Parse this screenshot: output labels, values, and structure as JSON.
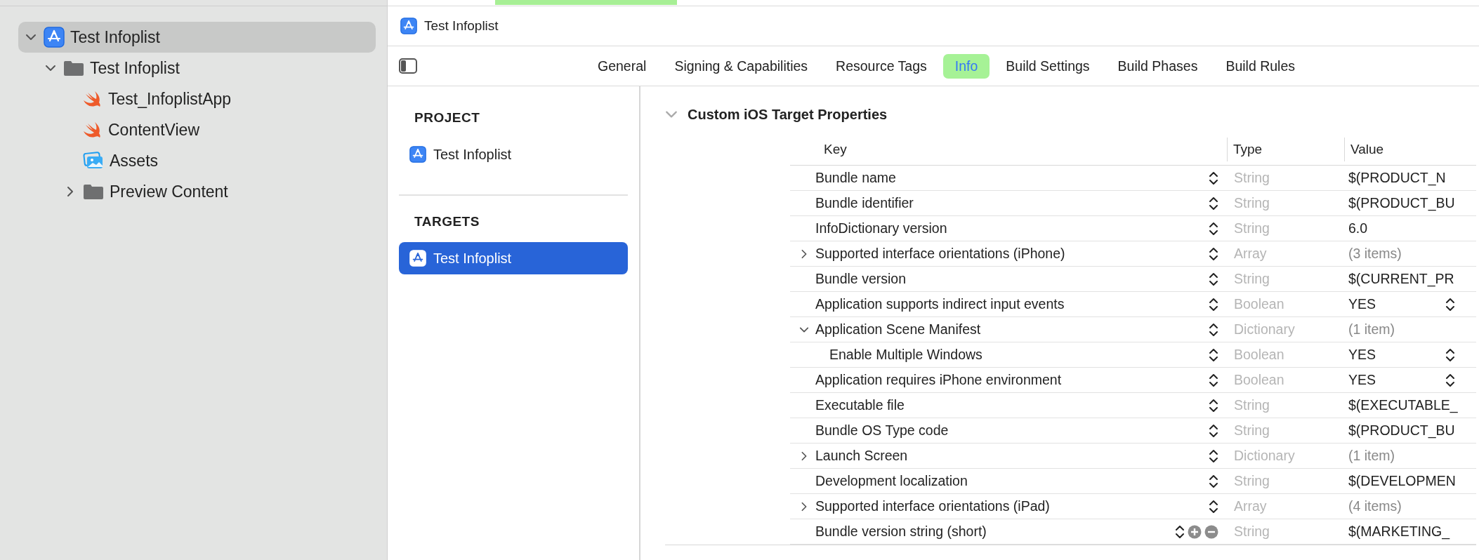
{
  "navigator": {
    "items": [
      {
        "label": "Test Infoplist",
        "kind": "project",
        "selected": true,
        "expanded": true,
        "children": [
          {
            "label": "Test Infoplist",
            "kind": "folder",
            "selected": false,
            "expanded": true,
            "children": [
              {
                "label": "Test_InfoplistApp",
                "kind": "swift",
                "selected": false
              },
              {
                "label": "ContentView",
                "kind": "swift",
                "selected": false
              },
              {
                "label": "Assets",
                "kind": "assets",
                "selected": false
              },
              {
                "label": "Preview Content",
                "kind": "folder",
                "selected": false,
                "expanded": false
              }
            ]
          }
        ]
      }
    ]
  },
  "editor": {
    "title": "Test Infoplist",
    "tabs": [
      {
        "label": "General",
        "selected": false
      },
      {
        "label": "Signing & Capabilities",
        "selected": false
      },
      {
        "label": "Resource Tags",
        "selected": false
      },
      {
        "label": "Info",
        "selected": true
      },
      {
        "label": "Build Settings",
        "selected": false
      },
      {
        "label": "Build Phases",
        "selected": false
      },
      {
        "label": "Build Rules",
        "selected": false
      }
    ],
    "project_section": {
      "heading": "PROJECT",
      "items": [
        {
          "label": "Test Infoplist",
          "selected": false
        }
      ]
    },
    "targets_section": {
      "heading": "TARGETS",
      "items": [
        {
          "label": "Test Infoplist",
          "selected": true
        }
      ]
    },
    "properties": {
      "title": "Custom iOS Target Properties",
      "expanded": true,
      "columns": [
        "Key",
        "Type",
        "Value"
      ],
      "rows": [
        {
          "key": "Bundle name",
          "type": "String",
          "value": "$(PRODUCT_N",
          "kind": "text"
        },
        {
          "key": "Bundle identifier",
          "type": "String",
          "value": "$(PRODUCT_BU",
          "kind": "text"
        },
        {
          "key": "InfoDictionary version",
          "type": "String",
          "value": "6.0",
          "kind": "text"
        },
        {
          "key": "Supported interface orientations (iPhone)",
          "type": "Array",
          "value": "(3 items)",
          "kind": "collection",
          "expanded": false
        },
        {
          "key": "Bundle version",
          "type": "String",
          "value": "$(CURRENT_PR",
          "kind": "text"
        },
        {
          "key": "Application supports indirect input events",
          "type": "Boolean",
          "value": "YES",
          "kind": "boolean"
        },
        {
          "key": "Application Scene Manifest",
          "type": "Dictionary",
          "value": "(1 item)",
          "kind": "collection",
          "expanded": true,
          "children": [
            {
              "key": "Enable Multiple Windows",
              "type": "Boolean",
              "value": "YES",
              "kind": "boolean"
            }
          ]
        },
        {
          "key": "Application requires iPhone environment",
          "type": "Boolean",
          "value": "YES",
          "kind": "boolean"
        },
        {
          "key": "Executable file",
          "type": "String",
          "value": "$(EXECUTABLE_",
          "kind": "text"
        },
        {
          "key": "Bundle OS Type code",
          "type": "String",
          "value": "$(PRODUCT_BU",
          "kind": "text"
        },
        {
          "key": "Launch Screen",
          "type": "Dictionary",
          "value": "(1 item)",
          "kind": "collection",
          "expanded": false
        },
        {
          "key": "Development localization",
          "type": "String",
          "value": "$(DEVELOPMEN",
          "kind": "text"
        },
        {
          "key": "Supported interface orientations (iPad)",
          "type": "Array",
          "value": "(4 items)",
          "kind": "collection",
          "expanded": false
        },
        {
          "key": "Bundle version string (short)",
          "type": "String",
          "value": "$(MARKETING_",
          "kind": "text",
          "editing": true
        }
      ]
    }
  }
}
